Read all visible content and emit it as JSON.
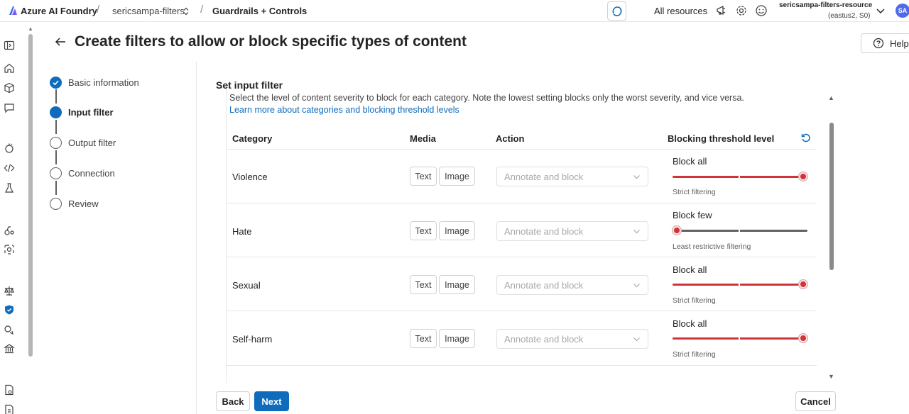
{
  "topbar": {
    "brand": "Azure AI Foundry",
    "project": "sericsampa-filters",
    "section": "Guardrails + Controls",
    "all_resources": "All resources",
    "account_name": "sericsampa-filters-resource",
    "account_region": "(eastus2, S0)",
    "avatar_initials": "SA"
  },
  "page": {
    "title": "Create filters to allow or block specific types of content",
    "help_label": "Help"
  },
  "steps": [
    {
      "label": "Basic information",
      "state": "done"
    },
    {
      "label": "Input filter",
      "state": "current"
    },
    {
      "label": "Output filter",
      "state": "pending"
    },
    {
      "label": "Connection",
      "state": "pending"
    },
    {
      "label": "Review",
      "state": "pending"
    }
  ],
  "content": {
    "section_title": "Set input filter",
    "description": "Select the level of content severity to block for each category. Note the lowest setting blocks only the worst severity, and vice versa.",
    "learn_more": "Learn more about categories and blocking threshold levels"
  },
  "table": {
    "headers": {
      "category": "Category",
      "media": "Media",
      "action": "Action",
      "threshold": "Blocking threshold level"
    },
    "rows": [
      {
        "category": "Violence",
        "media_text": "Text",
        "media_image": "Image",
        "action": "Annotate and block",
        "threshold_label": "Block all",
        "threshold_sub": "Strict filtering",
        "level": 1.0
      },
      {
        "category": "Hate",
        "media_text": "Text",
        "media_image": "Image",
        "action": "Annotate and block",
        "threshold_label": "Block few",
        "threshold_sub": "Least restrictive filtering",
        "level": 0.0
      },
      {
        "category": "Sexual",
        "media_text": "Text",
        "media_image": "Image",
        "action": "Annotate and block",
        "threshold_label": "Block all",
        "threshold_sub": "Strict filtering",
        "level": 1.0
      },
      {
        "category": "Self-harm",
        "media_text": "Text",
        "media_image": "Image",
        "action": "Annotate and block",
        "threshold_label": "Block all",
        "threshold_sub": "Strict filtering",
        "level": 1.0
      }
    ]
  },
  "footer": {
    "back": "Back",
    "next": "Next",
    "cancel": "Cancel"
  },
  "colors": {
    "accent": "#0f6cbd",
    "slider_active": "#d13438",
    "slider_inactive": "#616161"
  }
}
